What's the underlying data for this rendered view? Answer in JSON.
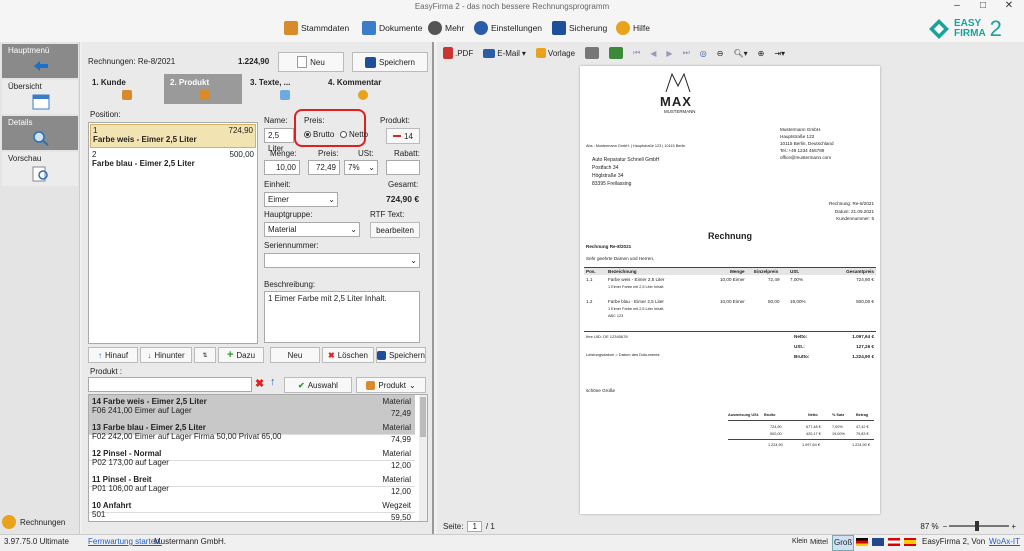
{
  "window": {
    "title": "EasyFirma 2 - das noch bessere Rechnungsprogramm"
  },
  "toolbar": {
    "stammdaten": "Stammdaten",
    "dokumente": "Dokumente",
    "mehr": "Mehr",
    "einstellungen": "Einstellungen",
    "sicherung": "Sicherung",
    "hilfe": "Hilfe"
  },
  "logo": {
    "line1": "EASY",
    "line2": "FIRMA",
    "version": "2"
  },
  "nav": {
    "hauptmenu": "Hauptmenü",
    "uebersicht": "Übersicht",
    "details": "Details",
    "vorschau": "Vorschau",
    "rechnungen": "Rechnungen"
  },
  "header": {
    "doc": "Rechnungen: Re-8/2021",
    "total": "1.224,90",
    "neu": "Neu",
    "speichern": "Speichern"
  },
  "tabs": [
    {
      "label": "1. Kunde"
    },
    {
      "label": "2. Produkt"
    },
    {
      "label": "3. Texte, ..."
    },
    {
      "label": "4. Kommentar"
    }
  ],
  "positions": {
    "label": "Position:",
    "items": [
      {
        "num": "1",
        "amount": "724,90",
        "name": "Farbe weis - Eimer 2,5 Liter"
      },
      {
        "num": "2",
        "amount": "500,00",
        "name": "Farbe blau - Eimer 2,5 Liter"
      }
    ]
  },
  "form": {
    "name_label": "Name:",
    "name_value": "2,5 Liter",
    "preis_label": "Preis:",
    "brutto": "Brutto",
    "netto": "Netto",
    "produkt_label": "Produkt:",
    "produkt_value": "14",
    "menge_label": "Menge:",
    "menge": "10,00",
    "preis2_label": "Preis:",
    "preis": "72,49",
    "ust_label": "USt:",
    "ust": "7%",
    "rabatt_label": "Rabatt:",
    "rabatt": "",
    "einheit_label": "Einheit:",
    "einheit": "Eimer",
    "gesamt_label": "Gesamt:",
    "gesamt": "724,90 €",
    "hauptgruppe_label": "Hauptgruppe:",
    "hauptgruppe": "Material",
    "rtf_label": "RTF Text:",
    "bearbeiten": "bearbeiten",
    "serien_label": "Seriennummer:",
    "serien": "",
    "beschreibung_label": "Beschreibung:",
    "beschreibung": "1 Eimer Farbe mit 2,5 Liter Inhalt."
  },
  "actions": {
    "hinauf": "Hinauf",
    "hinunter": "Hinunter",
    "dazu": "Dazu",
    "neu": "Neu",
    "loeschen": "Löschen",
    "speichern": "Speichern"
  },
  "produkt": {
    "label": "Produkt :",
    "search": "",
    "auswahl": "Auswahl",
    "produkt_btn": "Produkt",
    "items": [
      {
        "title": "14 Farbe weis - Eimer 2,5 Liter",
        "group": "Material",
        "sub": "F06 241,00 Eimer auf Lager",
        "price": "72,49"
      },
      {
        "title": "13 Farbe blau - Eimer 2,5 Liter",
        "group": "Material",
        "sub": "F02 242,00 Eimer auf Lager Firma 50,00  Privat 65,00",
        "price": "74,99"
      },
      {
        "title": "12 Pinsel - Normal",
        "group": "Material",
        "sub": "P02 173,00 auf Lager",
        "price": "12,00"
      },
      {
        "title": "11 Pinsel - Breit",
        "group": "Material",
        "sub": "P01 106,00 auf Lager",
        "price": "12,00"
      },
      {
        "title": "10 Anfahrt",
        "group": "Wegzeit",
        "sub": "501",
        "price": "59,50"
      }
    ]
  },
  "preview": {
    "pdf": ".PDF",
    "email": "E-Mail",
    "vorlage": "Vorlage",
    "seite_label": "Seite:",
    "seite": "1",
    "von": "/ 1",
    "zoom": "87 %"
  },
  "invoice": {
    "brand": "MAX",
    "brand_sub": "MUSTERMANN",
    "sender_line": "Abs.: Mustermann GmbH. | Hauptstraße 123 | 10115 Berlin",
    "company": [
      "Mustermann GmbH.",
      "Hauptstraße 123",
      "10115 Berlin, Deutschland",
      "Tel.:+49 1234 456789",
      "office@mustermann.com"
    ],
    "recipient": [
      "Auto Reparatur Schnell GmbH",
      "Postfach 34",
      "Höglstraße 34",
      "83395 Freilassing"
    ],
    "meta": [
      "Rechnung: Re-8/2021",
      "Datum: 21.09.2021",
      "Kundennummer: 5"
    ],
    "title": "Rechnung",
    "subject": "Rechnung Re-8/2021",
    "greeting": "Sehr geehrte Damen und Herren,",
    "cols": [
      "Pos.",
      "Bezeichnung",
      "Menge",
      "Einzelpreis",
      "USt.",
      "Gesamtpreis"
    ],
    "rows": [
      {
        "pos": "1.1",
        "desc": "Farbe weis - Eimer 2,5 Liter",
        "desc2": "1 Eimer Farbe mit 2,5 Liter Inhalt.",
        "menge": "10,00 Eimer",
        "ep": "72,49",
        "ust": "7,00%",
        "gp": "724,90 €"
      },
      {
        "pos": "1.2",
        "desc": "Farbe blau - Eimer 2,5 Liter",
        "desc2": "1 Eimer Farbe mit 2,5 Liter Inhalt.",
        "desc3": "ABC 123",
        "menge": "10,00 Eimer",
        "ep": "50,00",
        "ust": "19,00%",
        "gp": "500,00 €"
      }
    ],
    "uid": "Ihre UID: DE 12345678",
    "leistung": "Leistungsdatum = Datum des Dokuments",
    "netto_l": "Netto:",
    "netto": "1.097,64 €",
    "ust_l": "USt.:",
    "ust": "127,26 €",
    "brutto_l": "Brutto:",
    "brutto": "1.224,90 €",
    "closing": "schöne Grüße",
    "tax_cols": [
      "Ausweisung USt.",
      "Brutto",
      "Netto",
      "% Satz",
      "Betrag"
    ],
    "tax_rows": [
      [
        "724,90",
        "677,48 €",
        "7,00%",
        "47,42 €"
      ],
      [
        "500,00",
        "420,17 €",
        "19,00%",
        "79,83 €"
      ],
      [
        "1.224,90",
        "1.097,64 €",
        "",
        "1.224,90 €"
      ]
    ]
  },
  "status": {
    "version": "3.97.75.0 Ultimate",
    "fernwartung": "Fernwartung starten.",
    "firma": "Mustermann GmbH.",
    "klein": "Klein",
    "mittel": "Mittel",
    "gross": "Groß",
    "app": "EasyFirma 2, Von",
    "vendor": "WoAx-IT"
  }
}
